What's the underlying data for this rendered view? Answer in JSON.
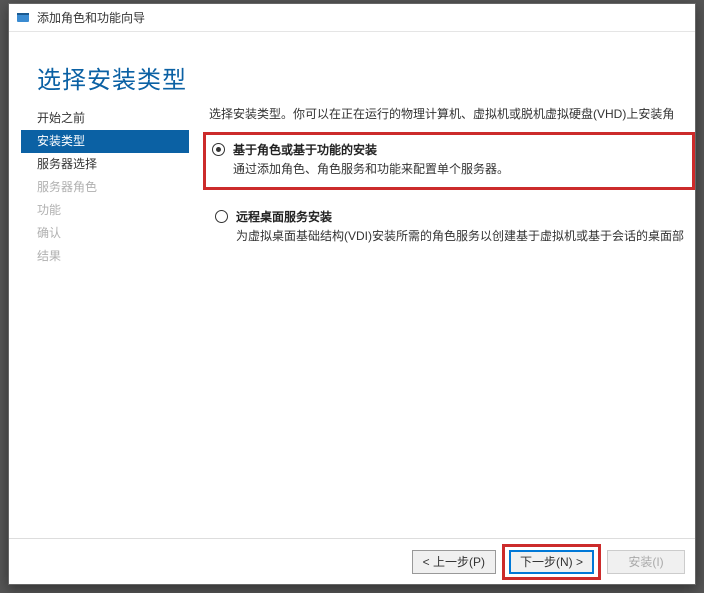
{
  "window": {
    "title": "添加角色和功能向导"
  },
  "page": {
    "title": "选择安装类型",
    "intro": "选择安装类型。你可以在正在运行的物理计算机、虚拟机或脱机虚拟硬盘(VHD)上安装角"
  },
  "sidebar": {
    "items": [
      {
        "label": "开始之前",
        "state": "enabled"
      },
      {
        "label": "安装类型",
        "state": "active"
      },
      {
        "label": "服务器选择",
        "state": "enabled"
      },
      {
        "label": "服务器角色",
        "state": "disabled"
      },
      {
        "label": "功能",
        "state": "disabled"
      },
      {
        "label": "确认",
        "state": "disabled"
      },
      {
        "label": "结果",
        "state": "disabled"
      }
    ]
  },
  "options": [
    {
      "title": "基于角色或基于功能的安装",
      "desc": "通过添加角色、角色服务和功能来配置单个服务器。",
      "checked": true,
      "highlighted": true
    },
    {
      "title": "远程桌面服务安装",
      "desc": "为虚拟桌面基础结构(VDI)安装所需的角色服务以创建基于虚拟机或基于会话的桌面部",
      "checked": false,
      "highlighted": false
    }
  ],
  "buttons": {
    "prev": "< 上一步(P)",
    "next": "下一步(N) >",
    "install": "安装(I)"
  }
}
